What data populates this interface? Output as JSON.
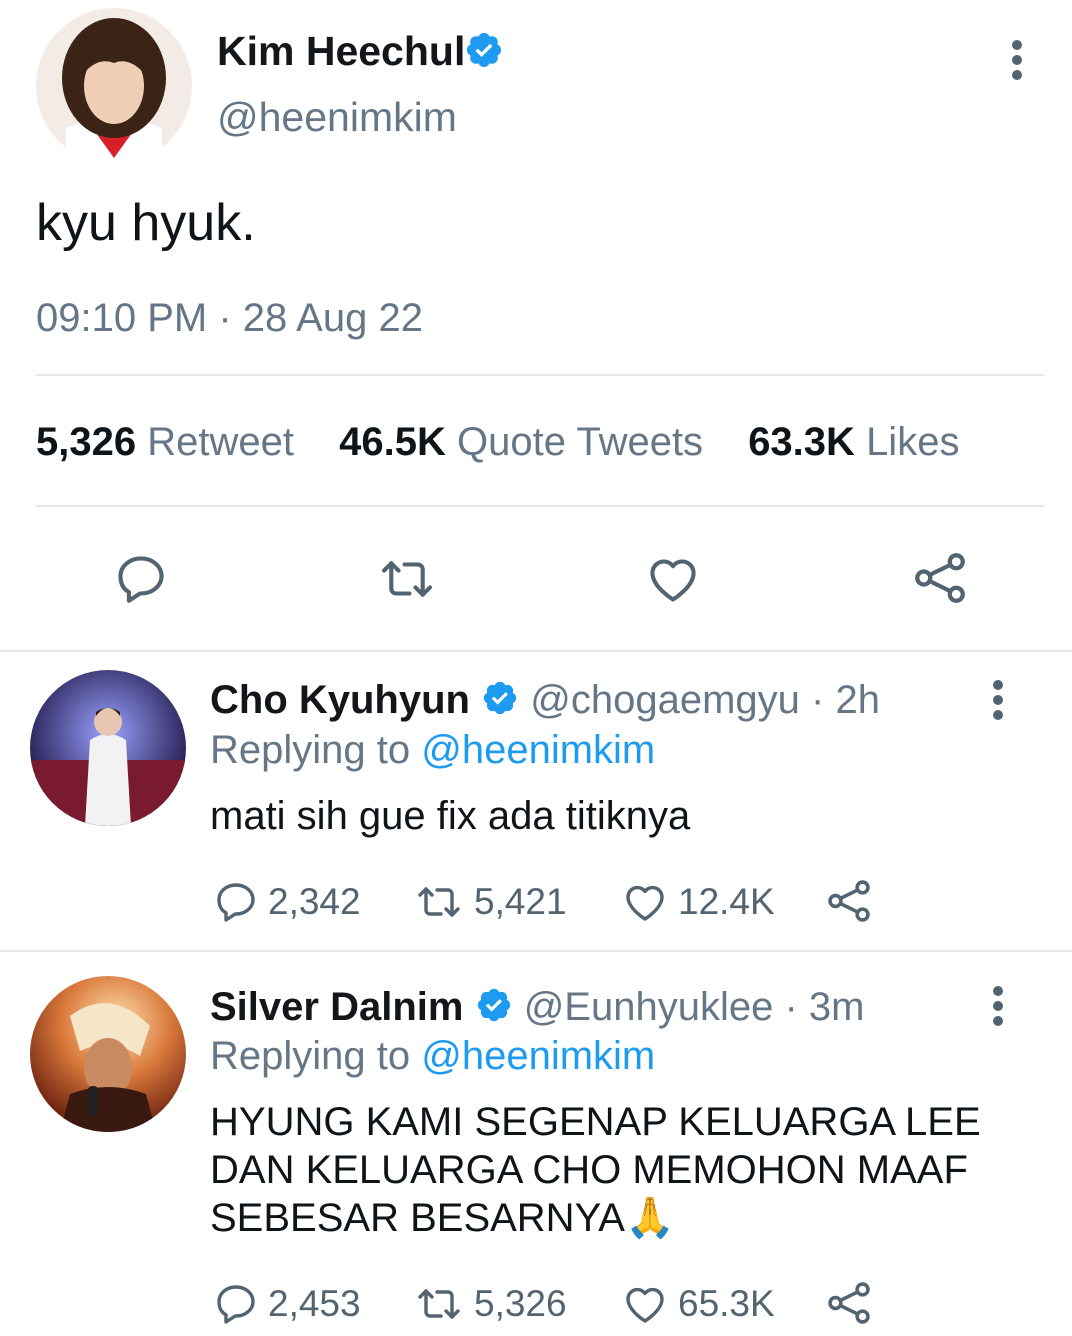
{
  "main_tweet": {
    "display_name": "Kim Heechul",
    "handle": "@heenimkim",
    "text": "kyu hyuk.",
    "timestamp": "09:10 PM · 28 Aug 22",
    "stats": {
      "retweets_count": "5,326",
      "retweets_label": "Retweet",
      "quotes_count": "46.5K",
      "quotes_label": "Quote Tweets",
      "likes_count": "63.3K",
      "likes_label": "Likes"
    }
  },
  "replies": [
    {
      "display_name": "Cho Kyuhyun",
      "handle": "@chogaemgyu",
      "time": "· 2h",
      "replying_prefix": "Replying to",
      "replying_to": "@heenimkim",
      "text": "mati sih gue fix ada titiknya",
      "reply_count": "2,342",
      "retweet_count": "5,421",
      "like_count": "12.4K"
    },
    {
      "display_name": "Silver Dalnim",
      "handle": "@Eunhyuklee",
      "time": "· 3m",
      "replying_prefix": "Replying to",
      "replying_to": "@heenimkim",
      "text_line1": "HYUNG KAMI SEGENAP KELUARGA LEE",
      "text_line2": "DAN KELUARGA CHO MEMOHON MAAF",
      "text_line3": "SEBESAR BESARNYA🙏",
      "reply_count": "2,453",
      "retweet_count": "5,326",
      "like_count": "65.3K"
    }
  ],
  "colors": {
    "accent": "#1d9bf0",
    "text": "#0f1419",
    "muted": "#657786",
    "divider": "#e1e8ed"
  },
  "icons": [
    "verified-badge-icon",
    "more-options-icon",
    "reply-icon",
    "retweet-icon",
    "like-icon",
    "share-icon"
  ]
}
